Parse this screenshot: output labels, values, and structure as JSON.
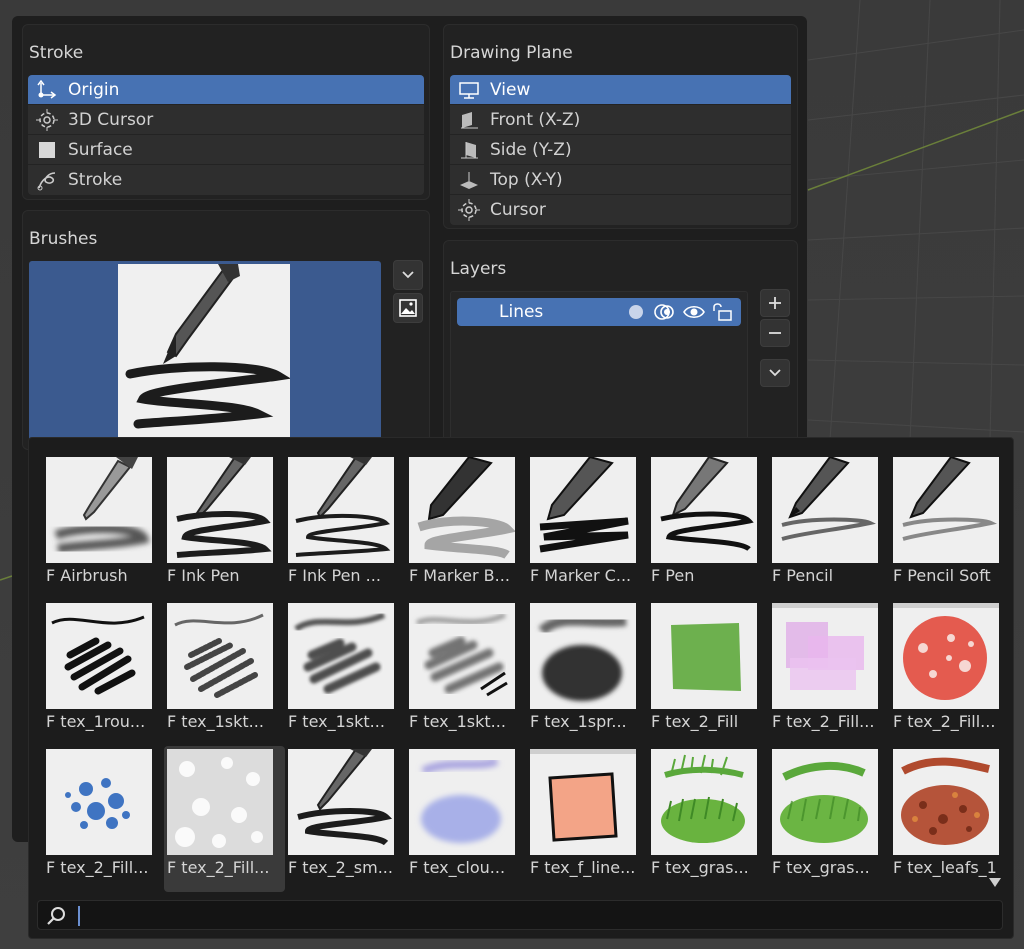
{
  "stroke": {
    "title": "Stroke",
    "items": [
      {
        "label": "Origin",
        "icon": "origin-icon",
        "active": true
      },
      {
        "label": "3D Cursor",
        "icon": "cursor-3d-icon",
        "active": false
      },
      {
        "label": "Surface",
        "icon": "surface-icon",
        "active": false
      },
      {
        "label": "Stroke",
        "icon": "stroke-icon",
        "active": false
      }
    ]
  },
  "drawing_plane": {
    "title": "Drawing Plane",
    "items": [
      {
        "label": "View",
        "icon": "view-icon",
        "active": true
      },
      {
        "label": "Front (X-Z)",
        "icon": "front-plane-icon",
        "active": false
      },
      {
        "label": "Side (Y-Z)",
        "icon": "side-plane-icon",
        "active": false
      },
      {
        "label": "Top (X-Y)",
        "icon": "top-plane-icon",
        "active": false
      },
      {
        "label": "Cursor",
        "icon": "cursor-icon",
        "active": false
      }
    ]
  },
  "brushes": {
    "title": "Brushes"
  },
  "layers": {
    "title": "Layers",
    "items": [
      {
        "label": "Lines"
      }
    ]
  },
  "brush_grid": [
    {
      "label": "F Airbrush"
    },
    {
      "label": "F Ink Pen"
    },
    {
      "label": "F Ink Pen ..."
    },
    {
      "label": "F Marker B..."
    },
    {
      "label": "F Marker C..."
    },
    {
      "label": "F Pen"
    },
    {
      "label": "F Pencil"
    },
    {
      "label": "F Pencil Soft"
    },
    {
      "label": "F tex_1rou..."
    },
    {
      "label": "F tex_1skt..."
    },
    {
      "label": "F tex_1skt..."
    },
    {
      "label": "F tex_1skt..."
    },
    {
      "label": "F tex_1spr..."
    },
    {
      "label": "F tex_2_Fill"
    },
    {
      "label": "F tex_2_Fill..."
    },
    {
      "label": "F tex_2_Fill..."
    },
    {
      "label": "F tex_2_Fill..."
    },
    {
      "label": "F tex_2_Fill..."
    },
    {
      "label": "F tex_2_sm..."
    },
    {
      "label": "F tex_clou..."
    },
    {
      "label": "F tex_f_line..."
    },
    {
      "label": "F tex_gras..."
    },
    {
      "label": "F tex_gras..."
    },
    {
      "label": "F tex_leafs_1"
    }
  ],
  "search": {
    "placeholder": "",
    "value": ""
  },
  "colors": {
    "accent": "#4772b3",
    "panel": "#1e1e1e"
  }
}
